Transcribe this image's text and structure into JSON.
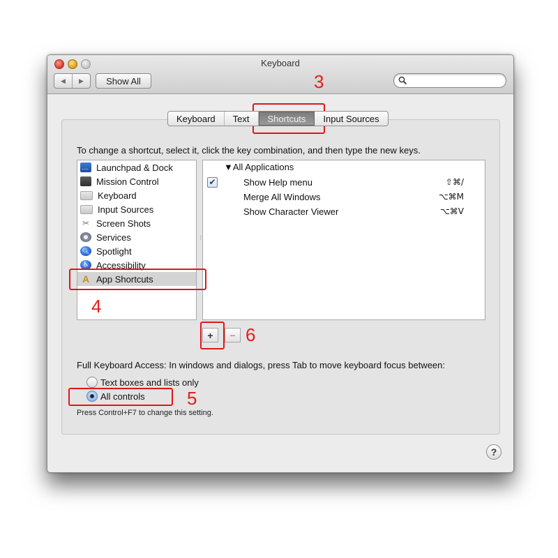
{
  "window": {
    "title": "Keyboard",
    "toolbar": {
      "back_label": "◀",
      "forward_label": "▶",
      "show_all_label": "Show All",
      "search_placeholder": "",
      "search_value": ""
    }
  },
  "tabs": [
    {
      "label": "Keyboard",
      "selected": false
    },
    {
      "label": "Text",
      "selected": false
    },
    {
      "label": "Shortcuts",
      "selected": true
    },
    {
      "label": "Input Sources",
      "selected": false
    }
  ],
  "instructions": "To change a shortcut, select it, click the key combination, and then type the new keys.",
  "categories": [
    {
      "label": "Launchpad & Dock",
      "icon": "launchpad-icon"
    },
    {
      "label": "Mission Control",
      "icon": "mission-control-icon"
    },
    {
      "label": "Keyboard",
      "icon": "keyboard-icon"
    },
    {
      "label": "Input Sources",
      "icon": "input-sources-icon"
    },
    {
      "label": "Screen Shots",
      "icon": "screen-shots-icon"
    },
    {
      "label": "Services",
      "icon": "services-gear-icon"
    },
    {
      "label": "Spotlight",
      "icon": "spotlight-icon"
    },
    {
      "label": "Accessibility",
      "icon": "accessibility-icon"
    },
    {
      "label": "App Shortcuts",
      "icon": "app-shortcuts-icon",
      "selected": true
    }
  ],
  "shortcuts": {
    "group_label": "▼All Applications",
    "rows": [
      {
        "checked": true,
        "name": "Show Help menu",
        "keys": "⇧⌘/"
      },
      {
        "checked": false,
        "name": "Merge All Windows",
        "keys": "⌥⌘M"
      },
      {
        "checked": false,
        "name": "Show Character Viewer",
        "keys": "⌥⌘V"
      }
    ]
  },
  "buttons": {
    "add_label": "+",
    "remove_label": "−",
    "help_label": "?"
  },
  "full_keyboard_access": {
    "label": "Full Keyboard Access: In windows and dialogs, press Tab to move keyboard focus between:",
    "options": [
      {
        "label": "Text boxes and lists only",
        "selected": false
      },
      {
        "label": "All controls",
        "selected": true
      }
    ],
    "hint": "Press Control+F7 to change this setting."
  },
  "annotations": {
    "step_tab": "3",
    "step_category": "4",
    "step_radio": "5",
    "step_add": "6",
    "color": "#e0161b"
  }
}
